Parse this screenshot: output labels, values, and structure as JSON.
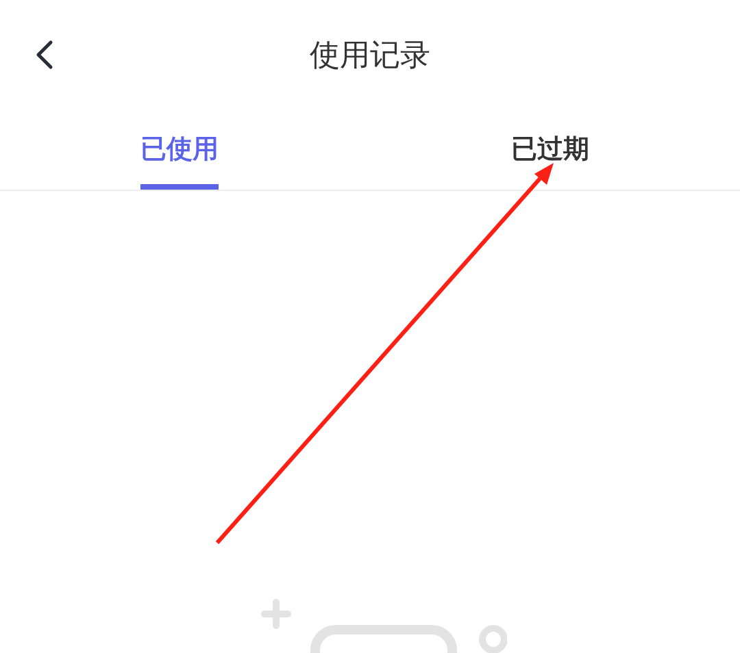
{
  "header": {
    "title": "使用记录"
  },
  "tabs": [
    {
      "label": "已使用",
      "selected": true
    },
    {
      "label": "已过期",
      "selected": false
    }
  ]
}
